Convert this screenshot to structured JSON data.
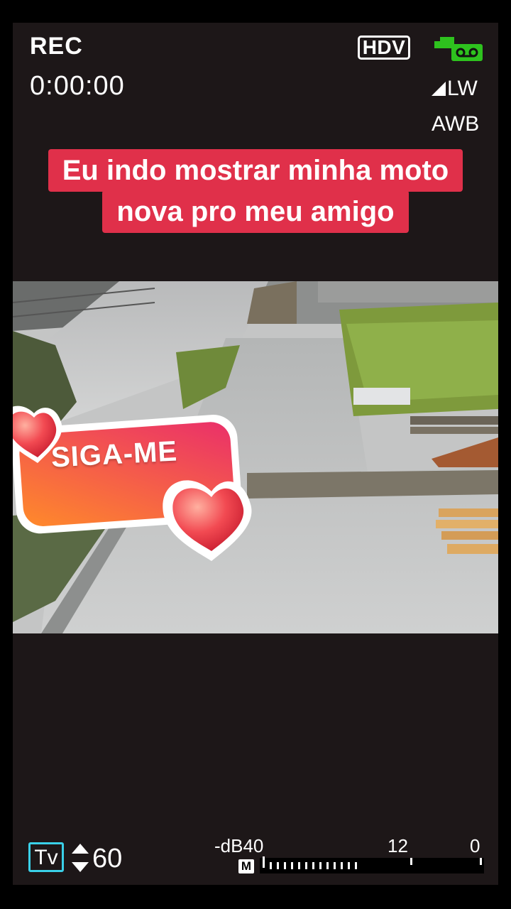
{
  "hud": {
    "rec_label": "REC",
    "timecode": "0:00:00",
    "format_badge": "HDV",
    "tape_icon": "tape-camera-icon",
    "wind_label": "LW",
    "white_balance": "AWB"
  },
  "caption": {
    "line1": "Eu indo mostrar minha moto",
    "line2": "nova pro meu amigo"
  },
  "sticker": {
    "label": "SIGA-ME",
    "icon": "heart-icon"
  },
  "bottom_hud": {
    "mode": "Tv",
    "shutter_speed": "60",
    "db_label": "-dB40",
    "level_12": "12",
    "level_0": "0",
    "mic_mode": "M"
  },
  "colors": {
    "caption_bg": "#e0304a",
    "tape_icon": "#2ec21e",
    "mode_border": "#3ad0e8",
    "sticker_gradient": [
      "#ff8a2a",
      "#ea2f6a"
    ],
    "viewfinder_bg": "#1d1718"
  }
}
